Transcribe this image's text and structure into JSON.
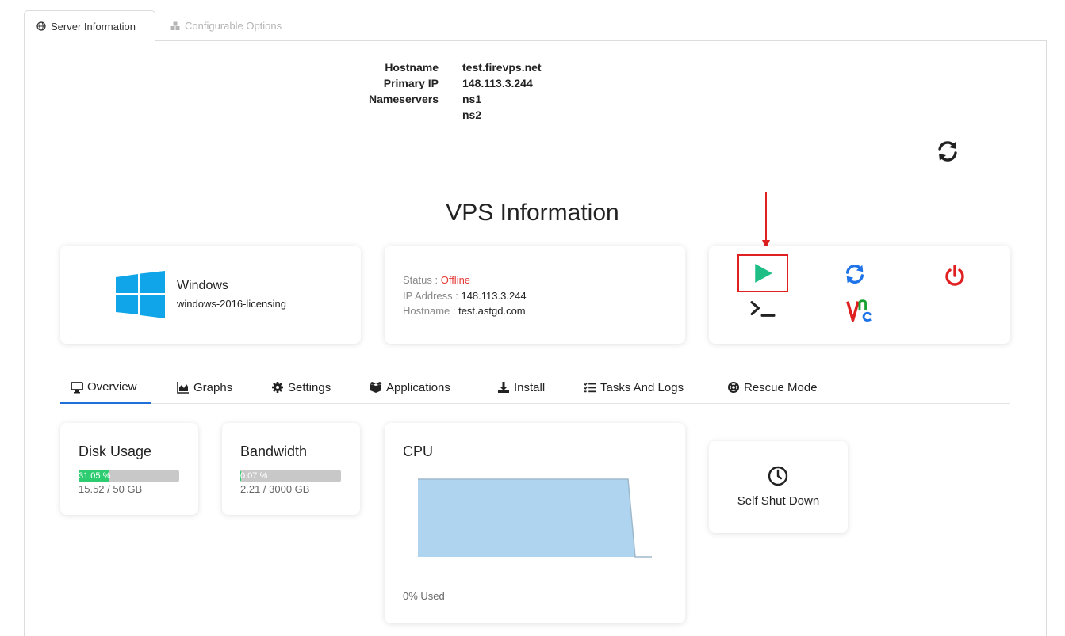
{
  "top_tabs": {
    "server_information": "Server Information",
    "configurable_options": "Configurable Options"
  },
  "server_info": {
    "hostname_label": "Hostname",
    "hostname_value": "test.firevps.net",
    "primary_ip_label": "Primary IP",
    "primary_ip_value": "148.113.3.244",
    "nameservers_label": "Nameservers",
    "ns1": "ns1",
    "ns2": "ns2"
  },
  "vps": {
    "title": "VPS Information",
    "os_name": "Windows",
    "os_template": "windows-2016-licensing",
    "status_label": "Status : ",
    "status_value": "Offline",
    "ip_label": "IP Address : ",
    "ip_value": "148.113.3.244",
    "hostname_label": "Hostname : ",
    "hostname_value": "test.astgd.com"
  },
  "nav_tabs": {
    "overview": "Overview",
    "graphs": "Graphs",
    "settings": "Settings",
    "applications": "Applications",
    "install": "Install",
    "tasks": "Tasks And Logs",
    "rescue": "Rescue Mode"
  },
  "disk": {
    "title": "Disk Usage",
    "percent_text": "31.05 %",
    "percent": 31.05,
    "usage": "15.52 / 50 GB"
  },
  "bandwidth": {
    "title": "Bandwidth",
    "percent_text": "0.07 %",
    "percent": 0.07,
    "usage": "2.21 / 3000 GB"
  },
  "cpu": {
    "title": "CPU",
    "used": "0% Used"
  },
  "self_shutdown": {
    "label": "Self Shut Down"
  },
  "colors": {
    "accent": "#1e6fd9",
    "offline": "#e53935",
    "start": "#1ebe85",
    "power": "#e02020",
    "bar_fill": "#2ecc71",
    "cpu_fill": "#aed4ef"
  },
  "icons": {
    "top_refresh": "sync-icon",
    "start": "play-icon",
    "restart": "sync-icon",
    "power": "power-icon",
    "console": "terminal-icon",
    "vnc": "vnc-icon"
  }
}
